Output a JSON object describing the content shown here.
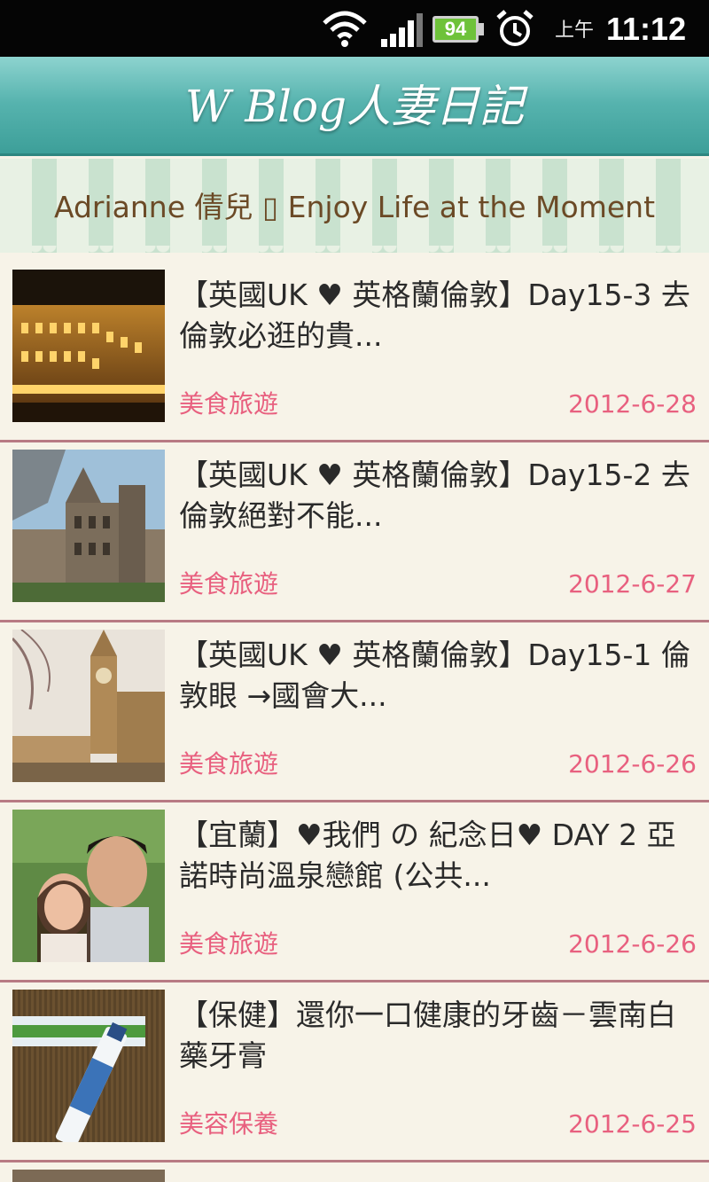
{
  "status_bar": {
    "battery_percent": "94",
    "ampm": "上午",
    "time": "11:12",
    "icons": [
      "wifi-icon",
      "signal-icon",
      "battery-icon",
      "alarm-clock-icon"
    ]
  },
  "app": {
    "title": "W Blog人妻日記",
    "accent_color": "#56b3ae"
  },
  "blog": {
    "tagline": "Adrianne 倩兒 ▯ Enjoy Life at the Moment"
  },
  "posts": [
    {
      "title": "【英國UK ♥ 英格蘭倫敦】Day15-3 去倫敦必逛的貴...",
      "category": "美食旅遊",
      "date": "2012-6-28",
      "thumbnail": "harrods-night-photo"
    },
    {
      "title": "【英國UK ♥ 英格蘭倫敦】Day15-2 去倫敦絕對不能...",
      "category": "美食旅遊",
      "date": "2012-6-27",
      "thumbnail": "natural-history-museum-photo"
    },
    {
      "title": "【英國UK ♥ 英格蘭倫敦】Day15-1 倫敦眼 →國會大...",
      "category": "美食旅遊",
      "date": "2012-6-26",
      "thumbnail": "big-ben-photo"
    },
    {
      "title": "【宜蘭】♥我們 の 紀念日♥ DAY 2 亞諾時尚溫泉戀館 (公共...",
      "category": "美食旅遊",
      "date": "2012-6-26",
      "thumbnail": "couple-selfie-photo"
    },
    {
      "title": "【保健】還你一口健康的牙齒－雲南白藥牙膏",
      "category": "美容保養",
      "date": "2012-6-25",
      "thumbnail": "toothpaste-photo"
    }
  ],
  "colors": {
    "category_text": "#e8607f",
    "title_text": "#2a2a2a",
    "divider": "#b87a83",
    "background": "#f7f3e8"
  }
}
